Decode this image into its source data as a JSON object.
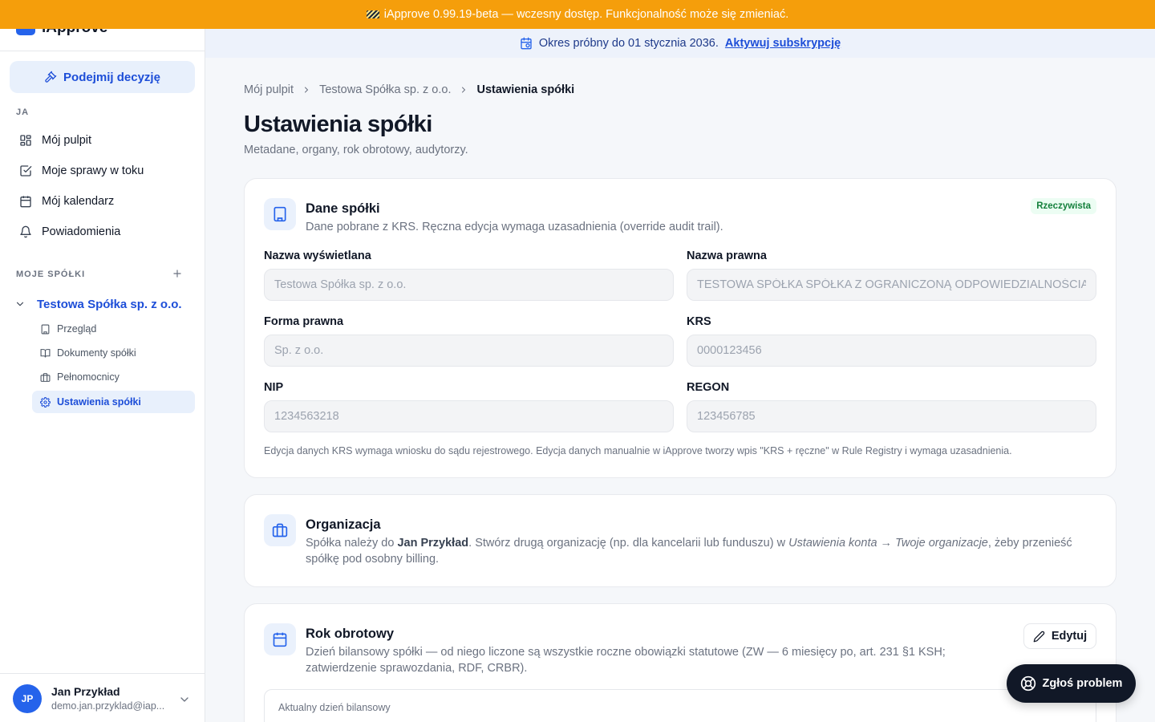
{
  "banner": {
    "text": "iApprove 0.99.19-beta — wczesny dostęp. Funkcjonalność może się zmieniać."
  },
  "app": {
    "name": "iApprove"
  },
  "trial": {
    "text": "Okres próbny do 01 stycznia 2036.",
    "link": "Aktywuj subskrypcję"
  },
  "sidebar": {
    "decision_button": "Podejmij decyzję",
    "section_me": "JA",
    "nav": [
      {
        "label": "Mój pulpit",
        "icon": "dashboard-icon"
      },
      {
        "label": "Moje sprawy w toku",
        "icon": "checkbox-icon"
      },
      {
        "label": "Mój kalendarz",
        "icon": "calendar-icon"
      },
      {
        "label": "Powiadomienia",
        "icon": "bell-icon"
      }
    ],
    "section_companies": "MOJE SPÓŁKI",
    "company": "Testowa Spółka sp. z o.o.",
    "sub_items": [
      {
        "label": "Przegląd",
        "icon": "building-icon"
      },
      {
        "label": "Dokumenty spółki",
        "icon": "book-icon"
      },
      {
        "label": "Pełnomocnicy",
        "icon": "briefcase-icon"
      },
      {
        "label": "Ustawienia spółki",
        "icon": "gear-icon",
        "active": true
      }
    ],
    "user": {
      "initials": "JP",
      "name": "Jan Przykład",
      "email": "demo.jan.przyklad@iap..."
    }
  },
  "breadcrumb": [
    "Mój pulpit",
    "Testowa Spółka sp. z o.o.",
    "Ustawienia spółki"
  ],
  "page": {
    "title": "Ustawienia spółki",
    "subtitle": "Metadane, organy, rok obrotowy, audytorzy."
  },
  "company_card": {
    "title": "Dane spółki",
    "description": "Dane pobrane z KRS. Ręczna edycja wymaga uzasadnienia (override audit trail).",
    "badge": "Rzeczywista",
    "fields": {
      "display_name": {
        "label": "Nazwa wyświetlana",
        "value": "Testowa Spółka sp. z o.o."
      },
      "legal_name": {
        "label": "Nazwa prawna",
        "value": "TESTOWA SPÓŁKA SPÓŁKA Z OGRANICZONĄ ODPOWIEDZIALNOŚCIĄ"
      },
      "legal_form": {
        "label": "Forma prawna",
        "value": "Sp. z o.o."
      },
      "krs": {
        "label": "KRS",
        "value": "0000123456"
      },
      "nip": {
        "label": "NIP",
        "value": "1234563218"
      },
      "regon": {
        "label": "REGON",
        "value": "123456785"
      }
    },
    "note": "Edycja danych KRS wymaga wniosku do sądu rejestrowego. Edycja danych manualnie w iApprove tworzy wpis \"KRS + ręczne\" w Rule Registry i wymaga uzasadnienia."
  },
  "org_card": {
    "title": "Organizacja",
    "desc_1": "Spółka należy do ",
    "owner": "Jan Przykład",
    "desc_2": ". Stwórz drugą organizację (np. dla kancelarii lub funduszu) w ",
    "path": "Ustawienia konta → Twoje organizacje",
    "desc_3": ", żeby przenieść spółkę pod osobny billing."
  },
  "fiscal_card": {
    "title": "Rok obrotowy",
    "description": "Dzień bilansowy spółki — od niego liczone są wszystkie roczne obowiązki statutowe (ZW — 6 miesięcy po, art. 231 §1 KSH; zatwierdzenie sprawozdania, RDF, CRBR).",
    "edit_button": "Edytuj",
    "current_label": "Aktualny dzień bilansowy"
  },
  "report_button": "Zgłoś problem",
  "colors": {
    "accent": "#2563eb",
    "banner": "#f59e0b",
    "success": "#15803d"
  }
}
